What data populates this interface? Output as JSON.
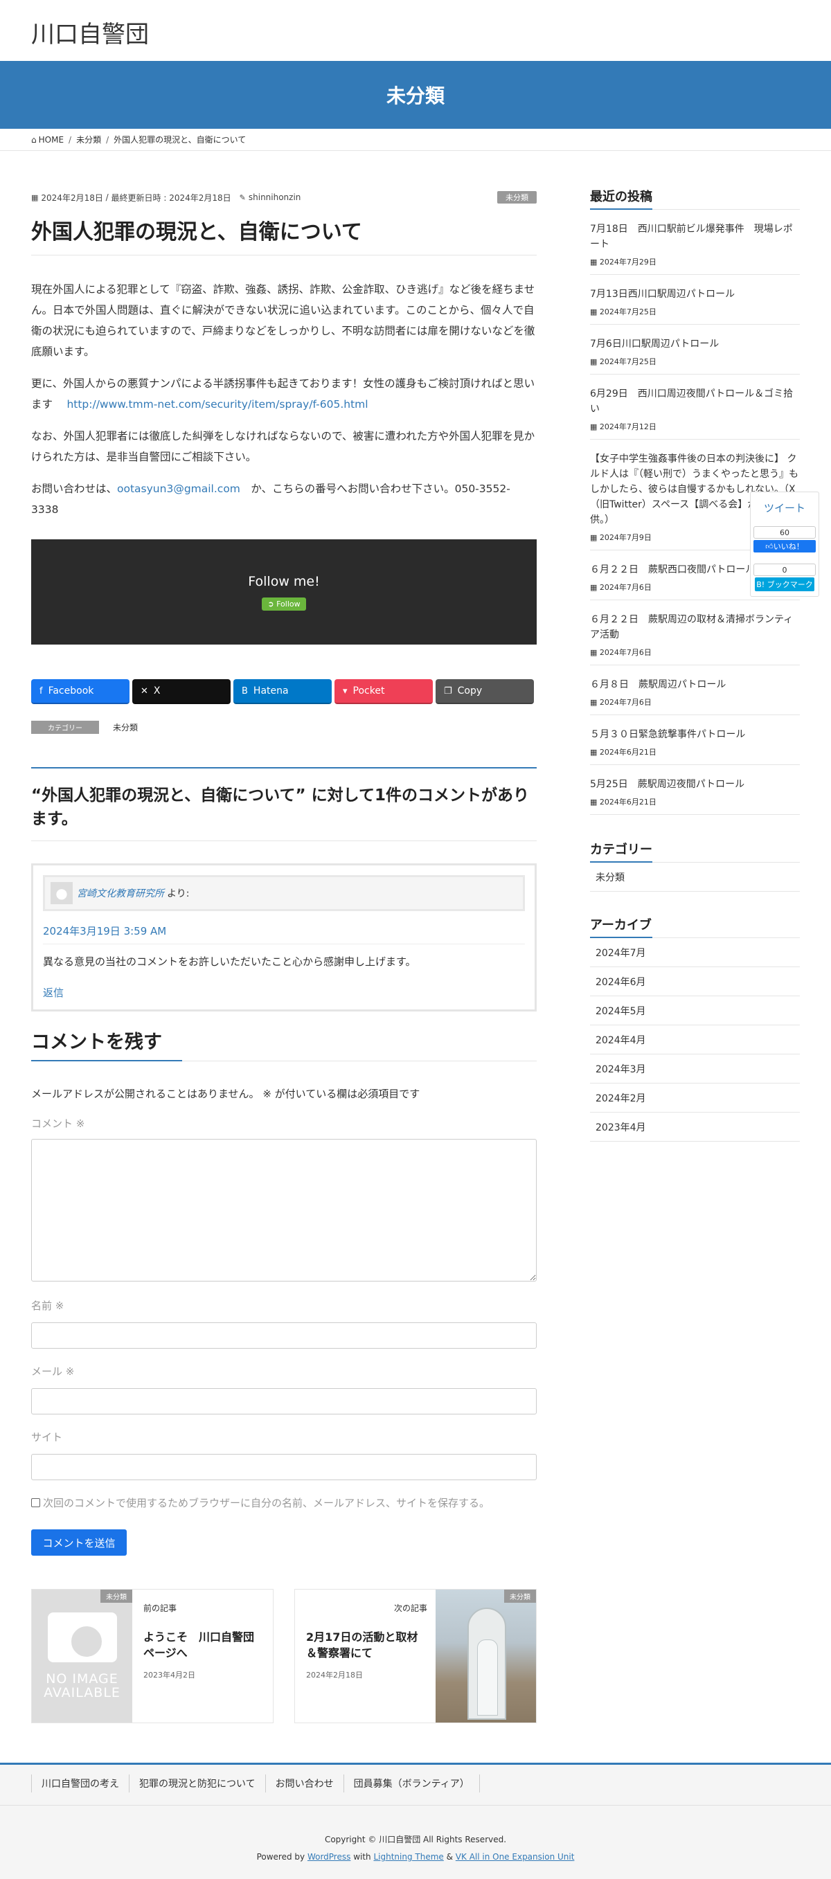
{
  "site": {
    "title": "川口自警団"
  },
  "banner": {
    "title": "未分類"
  },
  "breadcrumb": {
    "home": "HOME",
    "category": "未分類",
    "current": "外国人犯罪の現況と、自衛について"
  },
  "post": {
    "date": "2024年2月18日",
    "updated": "最終更新日時 : 2024年2月18日",
    "author": "shinnihonzin",
    "category_badge": "未分類",
    "title": "外国人犯罪の現況と、自衛について",
    "p1": "現在外国人による犯罪として『窃盗、詐欺、強姦、誘拐、詐欺、公金詐取、ひき逃げ』など後を経ちません。日本で外国人問題は、直ぐに解決ができない状況に追い込まれています。このことから、個々人で自衛の状況にも迫られていますので、戸締まりなどをしっかりし、不明な訪問者には扉を開けないなどを徹底願います。",
    "p2_text": "更に、外国人からの悪質ナンパによる半誘拐事件も起きております！女性の護身もご検討頂ければと思います",
    "p2_link": "http://www.tmm-net.com/security/item/spray/f-605.html",
    "p3": "なお、外国人犯罪者には徹底した糾弾をしなければならないので、被害に遭われた方や外国人犯罪を見かけられた方は、是非当自警団にご相談下さい。",
    "p4_pre": "お問い合わせは、",
    "p4_email": "ootasyun3@gmail.com",
    "p4_post": "　か、こちらの番号へお問い合わせ下さい。050-3552-3338",
    "follow_text": "Follow me!",
    "follow_btn": "Follow"
  },
  "share": [
    {
      "label": "Facebook",
      "color": "#1877f2",
      "icon": "facebook-icon",
      "glyph": "f"
    },
    {
      "label": "X",
      "color": "#111111",
      "icon": "x-icon",
      "glyph": "✕"
    },
    {
      "label": "Hatena",
      "color": "#0078c8",
      "icon": "hatena-icon",
      "glyph": "B"
    },
    {
      "label": "Pocket",
      "color": "#ef4056",
      "icon": "pocket-icon",
      "glyph": "▾"
    },
    {
      "label": "Copy",
      "color": "#555555",
      "icon": "copy-icon",
      "glyph": "❐"
    }
  ],
  "category_row": {
    "label": "カテゴリー",
    "value": "未分類"
  },
  "comments": {
    "title": "“外国人犯罪の現況と、自衛について” に対して1件のコメントがあります。",
    "author": "宮崎文化教育研究所",
    "says": "より:",
    "date": "2024年3月19日 3:59 AM",
    "text": "異なる意見の当社のコメントをお許しいただいたこと心から感謝申し上げます。",
    "reply": "返信"
  },
  "respond": {
    "title": "コメントを残す",
    "notes": "メールアドレスが公開されることはありません。 ※ が付いている欄は必須項目です",
    "comment_label": "コメント ※",
    "name_label": "名前 ※",
    "email_label": "メール ※",
    "site_label": "サイト",
    "cookie_label": "次回のコメントで使用するためブラウザーに自分の名前、メールアドレス、サイトを保存する。",
    "submit": "コメントを送信"
  },
  "post_nav": {
    "prev": {
      "badge": "未分類",
      "label": "前の記事",
      "title": "ようこそ　川口自警団ページへ",
      "date": "2023年4月2日",
      "noimg_line1": "NO IMAGE",
      "noimg_line2": "AVAILABLE"
    },
    "next": {
      "badge": "未分類",
      "label": "次の記事",
      "title": "2月17日の活動と取材＆警察署にて",
      "date": "2024年2月18日"
    }
  },
  "sidebar": {
    "recent_title": "最近の投稿",
    "recent": [
      {
        "title": "7月18日　西川口駅前ビル爆発事件　現場レポート",
        "date": "2024年7月29日"
      },
      {
        "title": "7月13日西川口駅周辺パトロール",
        "date": "2024年7月25日"
      },
      {
        "title": "7月6日川口駅周辺パトロール",
        "date": "2024年7月25日"
      },
      {
        "title": "6月29日　西川口周辺夜間パトロール＆ゴミ拾い",
        "date": "2024年7月12日"
      },
      {
        "title": "【女子中学生強姦事件後の日本の判決後に】 クルド人は『（軽い刑で）うまくやったと思う』もしかしたら、彼らは自慢するかもしれない。（X（旧Twitter）スペース【調べる会】からの提供。）",
        "date": "2024年7月9日"
      },
      {
        "title": "６月２２日　蕨駅西口夜間パトロール",
        "date": "2024年7月6日"
      },
      {
        "title": "６月２２日　蕨駅周辺の取材＆清掃ボランティア活動",
        "date": "2024年7月6日"
      },
      {
        "title": "６月８日　蕨駅周辺パトロール",
        "date": "2024年7月6日"
      },
      {
        "title": "５月３０日緊急銃撃事件パトロール",
        "date": "2024年6月21日"
      },
      {
        "title": "5月25日　蕨駅周辺夜間パトロール",
        "date": "2024年6月21日"
      }
    ],
    "category_title": "カテゴリー",
    "categories": [
      "未分類"
    ],
    "archive_title": "アーカイブ",
    "archives": [
      "2024年7月",
      "2024年6月",
      "2024年5月",
      "2024年4月",
      "2024年3月",
      "2024年2月",
      "2023年4月"
    ]
  },
  "float_share": {
    "tweet": "ツイート",
    "fb_count": "60",
    "fb_like": "いいね！",
    "hb_count": "0",
    "hb_label": "B! ブックマーク"
  },
  "footer": {
    "nav": [
      "川口自警団の考え",
      "犯罪の現況と防犯について",
      "お問い合わせ",
      "団員募集（ボランティア）"
    ],
    "copyright": "Copyright © 川口自警団 All Rights Reserved.",
    "powered_pre": "Powered by ",
    "wp": "WordPress",
    "with": " with ",
    "theme": "Lightning Theme",
    "amp": " & ",
    "vk": "VK All in One Expansion Unit"
  }
}
